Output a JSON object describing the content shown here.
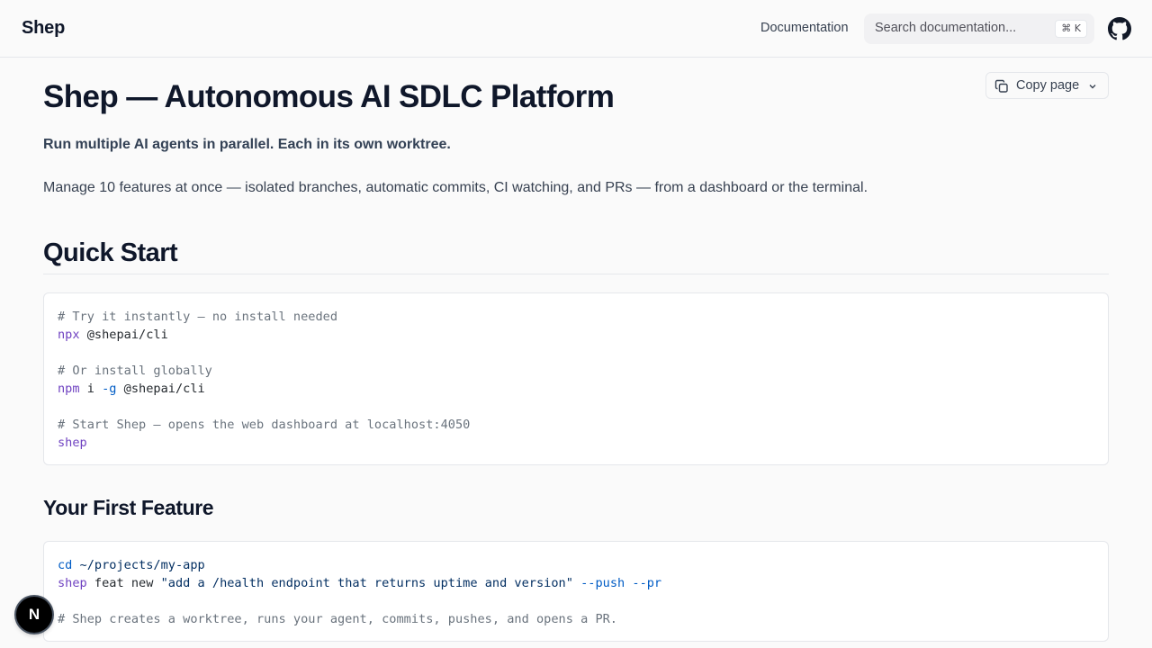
{
  "header": {
    "brand": "Shep",
    "nav_link": "Documentation",
    "search": {
      "placeholder": "Search documentation...",
      "shortcut": "⌘ K"
    }
  },
  "toolbar": {
    "copy_page_label": "Copy page"
  },
  "page": {
    "title": "Shep — Autonomous AI SDLC Platform",
    "lead": "Run multiple AI agents in parallel. Each in its own worktree.",
    "description": "Manage 10 features at once — isolated branches, automatic commits, CI watching, and PRs — from a dashboard or the terminal.",
    "quick_start": {
      "heading": "Quick Start",
      "code": {
        "comment_1": "# Try it instantly — no install needed",
        "cmd_1": "npx",
        "arg_1": " @shepai/cli",
        "comment_2": "# Or install globally",
        "cmd_2": "npm",
        "arg_2a": " i ",
        "flag_2": "-g",
        "arg_2b": " @shepai/cli",
        "comment_3": "# Start Shep — opens the web dashboard at localhost:4050",
        "cmd_3": "shep"
      }
    },
    "first_feature": {
      "heading": "Your First Feature",
      "code": {
        "cmd_1": "cd",
        "arg_1": " ~/projects/my-app",
        "cmd_2": "shep",
        "arg_2": " feat new ",
        "string_2": "\"add a /health endpoint that returns uptime and version\"",
        "flags_2": " --push --pr",
        "comment_3": "# Shep creates a worktree, runs your agent, commits, pushes, and opens a PR."
      }
    }
  },
  "badge": {
    "label": "N"
  },
  "colors": {
    "text": "#0f172a",
    "muted": "#374151",
    "border": "#e5e7eb",
    "code_comment": "#6a737d",
    "code_keyword": "#6f42c1",
    "code_flag": "#005cc5",
    "code_string": "#032f62"
  },
  "icons": [
    "github-icon",
    "copy-icon",
    "chevron-down-icon"
  ]
}
